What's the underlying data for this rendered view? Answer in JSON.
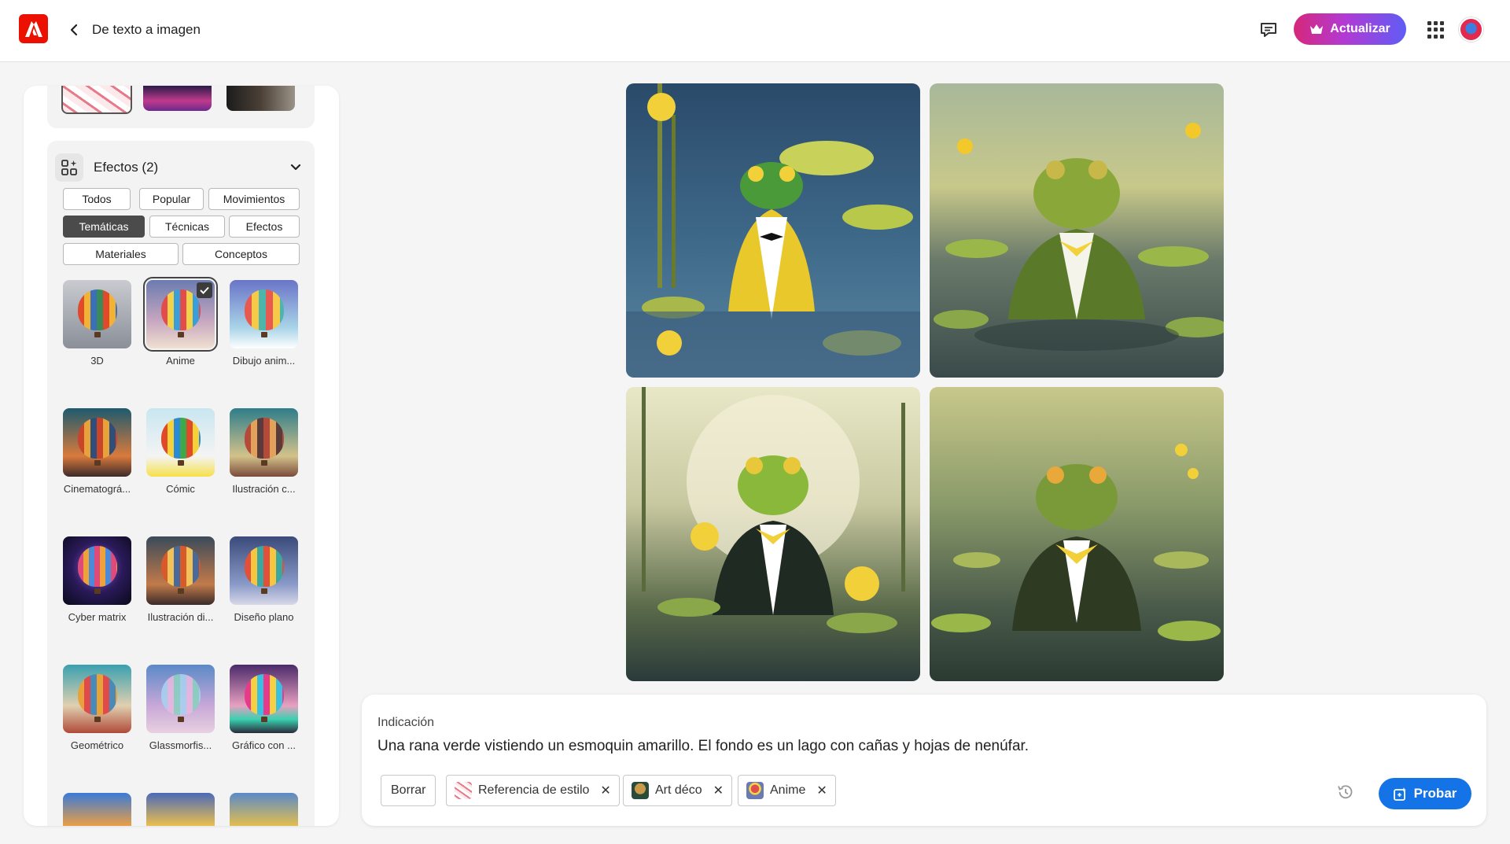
{
  "header": {
    "logo_icon": "adobe-logo-icon",
    "back_icon": "chevron-left-icon",
    "title": "De texto a imagen",
    "feedback_icon": "chat-icon",
    "upgrade_label": "Actualizar",
    "apps_icon": "app-grid-icon",
    "avatar_icon": "user-avatar",
    "upgrade_gradient": [
      "#d6277a",
      "#b23ad3",
      "#5f5cf5"
    ]
  },
  "sidebar": {
    "effects": {
      "title": "Efectos (2)",
      "filters": [
        {
          "label": "Todos",
          "active": false
        },
        {
          "label": "Popular",
          "active": false
        },
        {
          "label": "Movimientos",
          "active": false
        },
        {
          "label": "Temáticas",
          "active": true
        },
        {
          "label": "Técnicas",
          "active": false
        },
        {
          "label": "Efectos",
          "active": false
        },
        {
          "label": "Materiales",
          "active": false
        },
        {
          "label": "Conceptos",
          "active": false
        }
      ],
      "styles": [
        {
          "label": "3D",
          "selected": false
        },
        {
          "label": "Anime",
          "selected": true
        },
        {
          "label": "Dibujo anim...",
          "selected": false
        },
        {
          "label": "Cinematográ...",
          "selected": false
        },
        {
          "label": "Cómic",
          "selected": false
        },
        {
          "label": "Ilustración c...",
          "selected": false
        },
        {
          "label": "Cyber matrix",
          "selected": false
        },
        {
          "label": "Ilustración di...",
          "selected": false
        },
        {
          "label": "Diseño plano",
          "selected": false
        },
        {
          "label": "Geométrico",
          "selected": false
        },
        {
          "label": "Glassmorfis...",
          "selected": false
        },
        {
          "label": "Gráfico con ...",
          "selected": false
        }
      ]
    }
  },
  "results": {
    "images": [
      {
        "name": "frog-yellow-tuxedo"
      },
      {
        "name": "frog-green-suit-yellow-bow"
      },
      {
        "name": "frog-black-suit-yellow-bow"
      },
      {
        "name": "frog-green-suit-lily-pads"
      }
    ]
  },
  "prompt": {
    "label": "Indicación",
    "text": "Una rana verde vistiendo un esmoquin amarillo. El fondo es un lago con cañas y hojas de nenúfar.",
    "clear_label": "Borrar",
    "tags": [
      {
        "label": "Referencia de estilo"
      },
      {
        "label": "Art déco"
      },
      {
        "label": "Anime"
      }
    ],
    "remove_icon": "close-icon",
    "history_icon": "history-icon",
    "try_label": "Probar",
    "try_color": "#1473e6"
  }
}
